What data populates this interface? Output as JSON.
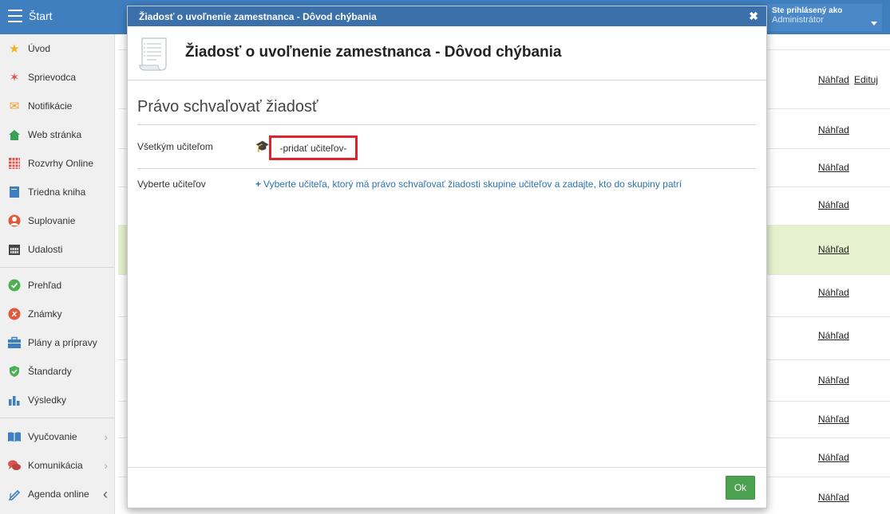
{
  "topbar": {
    "start_label": "Štart",
    "user_line1": "Ste prihlásený ako",
    "user_line2": "Administrátor"
  },
  "sidebar": {
    "items": [
      {
        "label": "Úvod",
        "icon": "star-icon",
        "color": "#f2b01e"
      },
      {
        "label": "Sprievodca",
        "icon": "wand-icon",
        "color": "#d9534f"
      },
      {
        "label": "Notifikácie",
        "icon": "envelope-icon",
        "color": "#f0a030"
      },
      {
        "label": "Web stránka",
        "icon": "house-icon",
        "color": "#3aa055"
      },
      {
        "label": "Rozvrhy Online",
        "icon": "calendar-grid-icon",
        "color": "#d9534f"
      },
      {
        "label": "Triedna kniha",
        "icon": "book-icon",
        "color": "#3f7fc0"
      },
      {
        "label": "Suplovanie",
        "icon": "person-icon",
        "color": "#e05a3a"
      },
      {
        "label": "Udalosti",
        "icon": "calendar-icon",
        "color": "#444444"
      },
      {
        "label": "Prehľad",
        "icon": "check-circle-icon",
        "color": "#4caf50"
      },
      {
        "label": "Známky",
        "icon": "grade-icon",
        "color": "#e05a3a"
      },
      {
        "label": "Plány a prípravy",
        "icon": "briefcase-icon",
        "color": "#3f7fc0"
      },
      {
        "label": "Štandardy",
        "icon": "shield-check-icon",
        "color": "#4caf50"
      },
      {
        "label": "Výsledky",
        "icon": "bar-chart-icon",
        "color": "#3f7fc0"
      },
      {
        "label": "Vyučovanie",
        "icon": "open-book-icon",
        "color": "#3f7fc0"
      },
      {
        "label": "Komunikácia",
        "icon": "chat-icon",
        "color": "#d9534f"
      },
      {
        "label": "Agenda online",
        "icon": "pen-icon",
        "color": "#3f7fc0"
      }
    ]
  },
  "background": {
    "preview_label": "Náhľad",
    "edit_label": "Edituj"
  },
  "modal": {
    "header_title": "Žiadosť o uvoľnenie zamestnanca - Dôvod chýbania",
    "title": "Žiadosť o uvoľnenie zamestnanca - Dôvod chýbania",
    "section_title": "Právo schvaľovať žiadosť",
    "all_teachers_label": "Všetkým učiteľom",
    "add_teachers": "-pridať učiteľov-",
    "select_teachers_label": "Vyberte učiteľov",
    "select_teachers_link": "Vyberte učiteľa, ktorý má právo schvaľovať žiadosti skupine učiteľov a zadajte, kto do skupiny patrí",
    "ok_label": "Ok"
  },
  "colors": {
    "topbar": "#3f7fc0",
    "modal_header": "#3c70ab",
    "highlight_row": "#e6f2cf",
    "ok_button": "#4aa24f",
    "highlight_border": "#e0222d",
    "link": "#2c73b3"
  }
}
